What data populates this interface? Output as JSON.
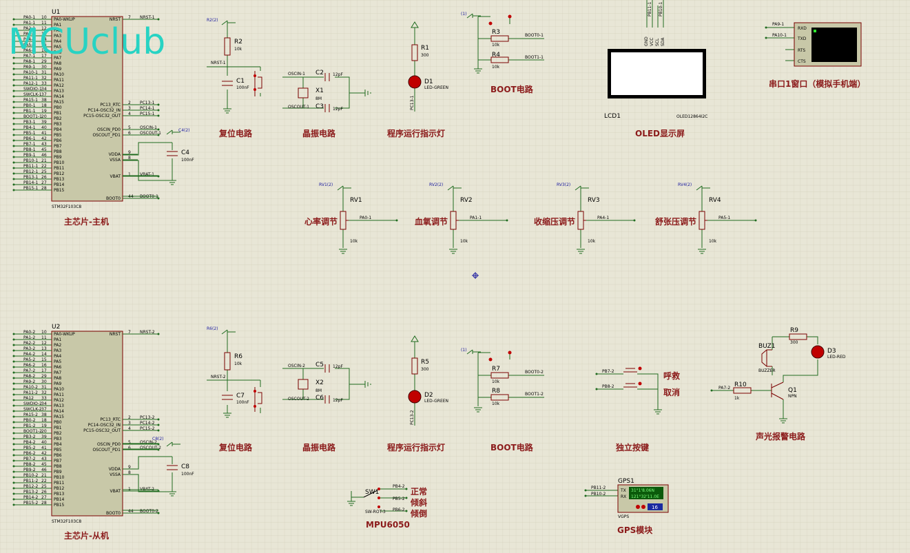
{
  "watermark": "MCUclub",
  "colors": {
    "background": "#e8e6d6",
    "grid": "#d7d4c0",
    "wire": "#1f6b1f",
    "caption": "#8b1a1a",
    "chip": "#c8c8a8",
    "led": "#c00000",
    "component": "#7a0000"
  },
  "u1": {
    "ref": "U1",
    "part": "STM32F103C8",
    "caption": "主芯片-主机",
    "left_nets": [
      "PA0-1",
      "PA1-1",
      "PA2-1",
      "PA3-1",
      "PA4-1",
      "PA5-1",
      "PA6-1",
      "PA7-1",
      "PA8-1",
      "PA9-1",
      "PA10-1",
      "PA11-1",
      "PA12-1",
      "SWDIO-1",
      "SWCLK-1",
      "PA15-1",
      "PB0-1",
      "PB1-1",
      "BOOT1-1",
      "PB3-1",
      "PB4-1",
      "PB5-1",
      "PB6-1",
      "PB7-1",
      "PB8-1",
      "PB9-1",
      "PB10-1",
      "PB11-1",
      "PB12-1",
      "PB13-1",
      "PB14-1",
      "PB15-1"
    ],
    "right_nets": [
      "NRST-1",
      "PC13-1",
      "PC14-1",
      "PC15-1",
      "OSCIN-1",
      "OSCOUT-1",
      "VBAT-1",
      "BOOT0-1"
    ]
  },
  "u2": {
    "ref": "U2",
    "part": "STM32F103C8",
    "caption": "主芯片-从机",
    "left_nets": [
      "PA0-2",
      "PA1-2",
      "PA2-2",
      "PA3-2",
      "PA4-2",
      "PA5-2",
      "PA6-2",
      "PA7-2",
      "PA8-2",
      "PA9-2",
      "PA10-2",
      "PA11-2",
      "PA12",
      "SWDIO-2",
      "SWCLK-2",
      "PA15-2",
      "PB0-2",
      "PB1-2",
      "BOOT1-2",
      "PB3-2",
      "PB4-2",
      "PB5-2",
      "PB6-2",
      "PB7-2",
      "PB8-2",
      "PB9-2",
      "PB10-2",
      "PB11-2",
      "PB12-2",
      "PB13-2",
      "PB14-2",
      "PB15-2"
    ],
    "right_nets": [
      "NRST-2",
      "PC13-2",
      "PC14-2",
      "PC15-2",
      "OSCIN-2",
      "OSCOUT-2",
      "VBAT-2",
      "BOOT0-2"
    ]
  },
  "chip_pins": {
    "left_names": [
      "PA0-WKUP",
      "PA1",
      "PA2",
      "PA3",
      "PA4",
      "PA5",
      "PA6",
      "PA7",
      "PA8",
      "PA9",
      "PA10",
      "PA11",
      "PA12",
      "PA13",
      "PA14",
      "PA15",
      "PB0",
      "PB1",
      "PB2",
      "PB3",
      "PB4",
      "PB5",
      "PB6",
      "PB7",
      "PB8",
      "PB9",
      "PB10",
      "PB11",
      "PB12",
      "PB13",
      "PB14",
      "PB15"
    ],
    "left_numbers": [
      "10",
      "11",
      "12",
      "13",
      "14",
      "15",
      "16",
      "17",
      "29",
      "30",
      "31",
      "32",
      "33",
      "34",
      "37",
      "38",
      "18",
      "19",
      "20",
      "39",
      "40",
      "41",
      "42",
      "43",
      "45",
      "46",
      "21",
      "22",
      "25",
      "26",
      "27",
      "28"
    ],
    "right_names": [
      "NRST",
      "PC13_RTC",
      "PC14-OSC32_IN",
      "PC15-OSC32_OUT",
      "OSCIN_PD0",
      "OSCOUT_PD1",
      "VDDA",
      "VSSA",
      "VBAT",
      "BOOT0"
    ],
    "right_numbers": [
      "7",
      "2",
      "3",
      "4",
      "5",
      "6",
      "9",
      "8",
      "1",
      "44"
    ]
  },
  "reset1": {
    "caption": "复位电路",
    "r_ref": "R2",
    "r_val": "10k",
    "c_ref": "C1",
    "c_val": "100nF",
    "net": "NRST-1",
    "power": "R2(2)"
  },
  "reset2": {
    "caption": "复位电路",
    "r_ref": "R6",
    "r_val": "10k",
    "c_ref": "C7",
    "c_val": "100nF",
    "net": "NRST-2",
    "power": "R6(2)"
  },
  "xtal1": {
    "caption": "晶振电路",
    "x_ref": "X1",
    "x_val": "8M",
    "c_a": "C2",
    "c_b": "C3",
    "c_val": "12pF",
    "net_a": "OSCIN-1",
    "net_b": "OSCOUT-1"
  },
  "xtal2": {
    "caption": "晶振电路",
    "x_ref": "X2",
    "x_val": "8M",
    "c_a": "C5",
    "c_b": "C6",
    "c_val": "12pF",
    "net_a": "OSCIN-2",
    "net_b": "OSCOUT-2"
  },
  "vdda1": {
    "c_ref": "C4",
    "c_val": "100nF",
    "power": "C4(2)"
  },
  "vdda2": {
    "c_ref": "C8",
    "c_val": "100nF",
    "power": "C8(2)"
  },
  "led1": {
    "caption": "程序运行指示灯",
    "r_ref": "R1",
    "r_val": "300",
    "d_ref": "D1",
    "d_val": "LED-GREEN",
    "net": "PC13-1"
  },
  "led2": {
    "caption": "程序运行指示灯",
    "r_ref": "R5",
    "r_val": "300",
    "d_ref": "D2",
    "d_val": "LED-GREEN",
    "net": "PC13-2"
  },
  "boot1": {
    "caption": "BOOT电路",
    "ra": "R3",
    "rb": "R4",
    "r_val": "10k",
    "net_a": "BOOT0-1",
    "net_b": "BOOT1-1",
    "power": "(1)"
  },
  "boot2": {
    "caption": "BOOT电路",
    "ra": "R7",
    "rb": "R8",
    "r_val": "10k",
    "net_a": "BOOT0-2",
    "net_b": "BOOT1-2",
    "power": "(1)"
  },
  "oled": {
    "caption": "OLED显示屏",
    "ref": "LCD1",
    "part": "OLED12864I2C",
    "pins": [
      "GND",
      "VCC",
      "SCL",
      "SDA"
    ],
    "nets": [
      "PB11-1",
      "PB10-1"
    ]
  },
  "uart": {
    "caption": "串口1窗口（模拟手机端）",
    "nets": [
      "PA9-1",
      "PA10-1"
    ],
    "pins": [
      "RXD",
      "TXD",
      "RTS",
      "CTS"
    ]
  },
  "pots": [
    {
      "ref": "RV1",
      "val": "10k",
      "label": "心率调节",
      "net": "PA0-1",
      "power": "RV1(2)"
    },
    {
      "ref": "RV2",
      "val": "10k",
      "label": "血氧调节",
      "net": "PA1-1",
      "power": "RV2(2)"
    },
    {
      "ref": "RV3",
      "val": "10k",
      "label": "收缩压调节",
      "net": "PA4-1",
      "power": "RV3(2)"
    },
    {
      "ref": "RV4",
      "val": "10k",
      "label": "舒张压调节",
      "net": "PA5-1",
      "power": "RV4(2)"
    }
  ],
  "keys": {
    "caption": "独立按键",
    "nets": [
      "PB7-2",
      "PB8-2"
    ],
    "labels": [
      "呼救",
      "取消"
    ]
  },
  "alarm": {
    "caption": "声光报警电路",
    "buz": "BUZ1",
    "buz_val": "BUZZER",
    "r9": "R9",
    "r9_val": "300",
    "d3": "D3",
    "d3_val": "LED-RED",
    "r10": "R10",
    "r10_val": "1k",
    "q1": "Q1",
    "q1_val": "NPN",
    "net": "PA7-2"
  },
  "mpu": {
    "caption": "MPU6050",
    "ref": "SW1",
    "part": "SW-ROT-3",
    "nets": [
      "PB4-2",
      "PB5-2",
      "PB6-2"
    ],
    "labels": [
      "正常",
      "倾斜",
      "倾倒"
    ]
  },
  "gps": {
    "caption": "GPS模块",
    "ref": "GPS1",
    "part": "VGPS",
    "pins": [
      "TX",
      "RX"
    ],
    "nets": [
      "PB11-2",
      "PB10-2"
    ],
    "line1": "31°1'8.06N",
    "line2": "121°32'11.0E",
    "sats": "16"
  }
}
